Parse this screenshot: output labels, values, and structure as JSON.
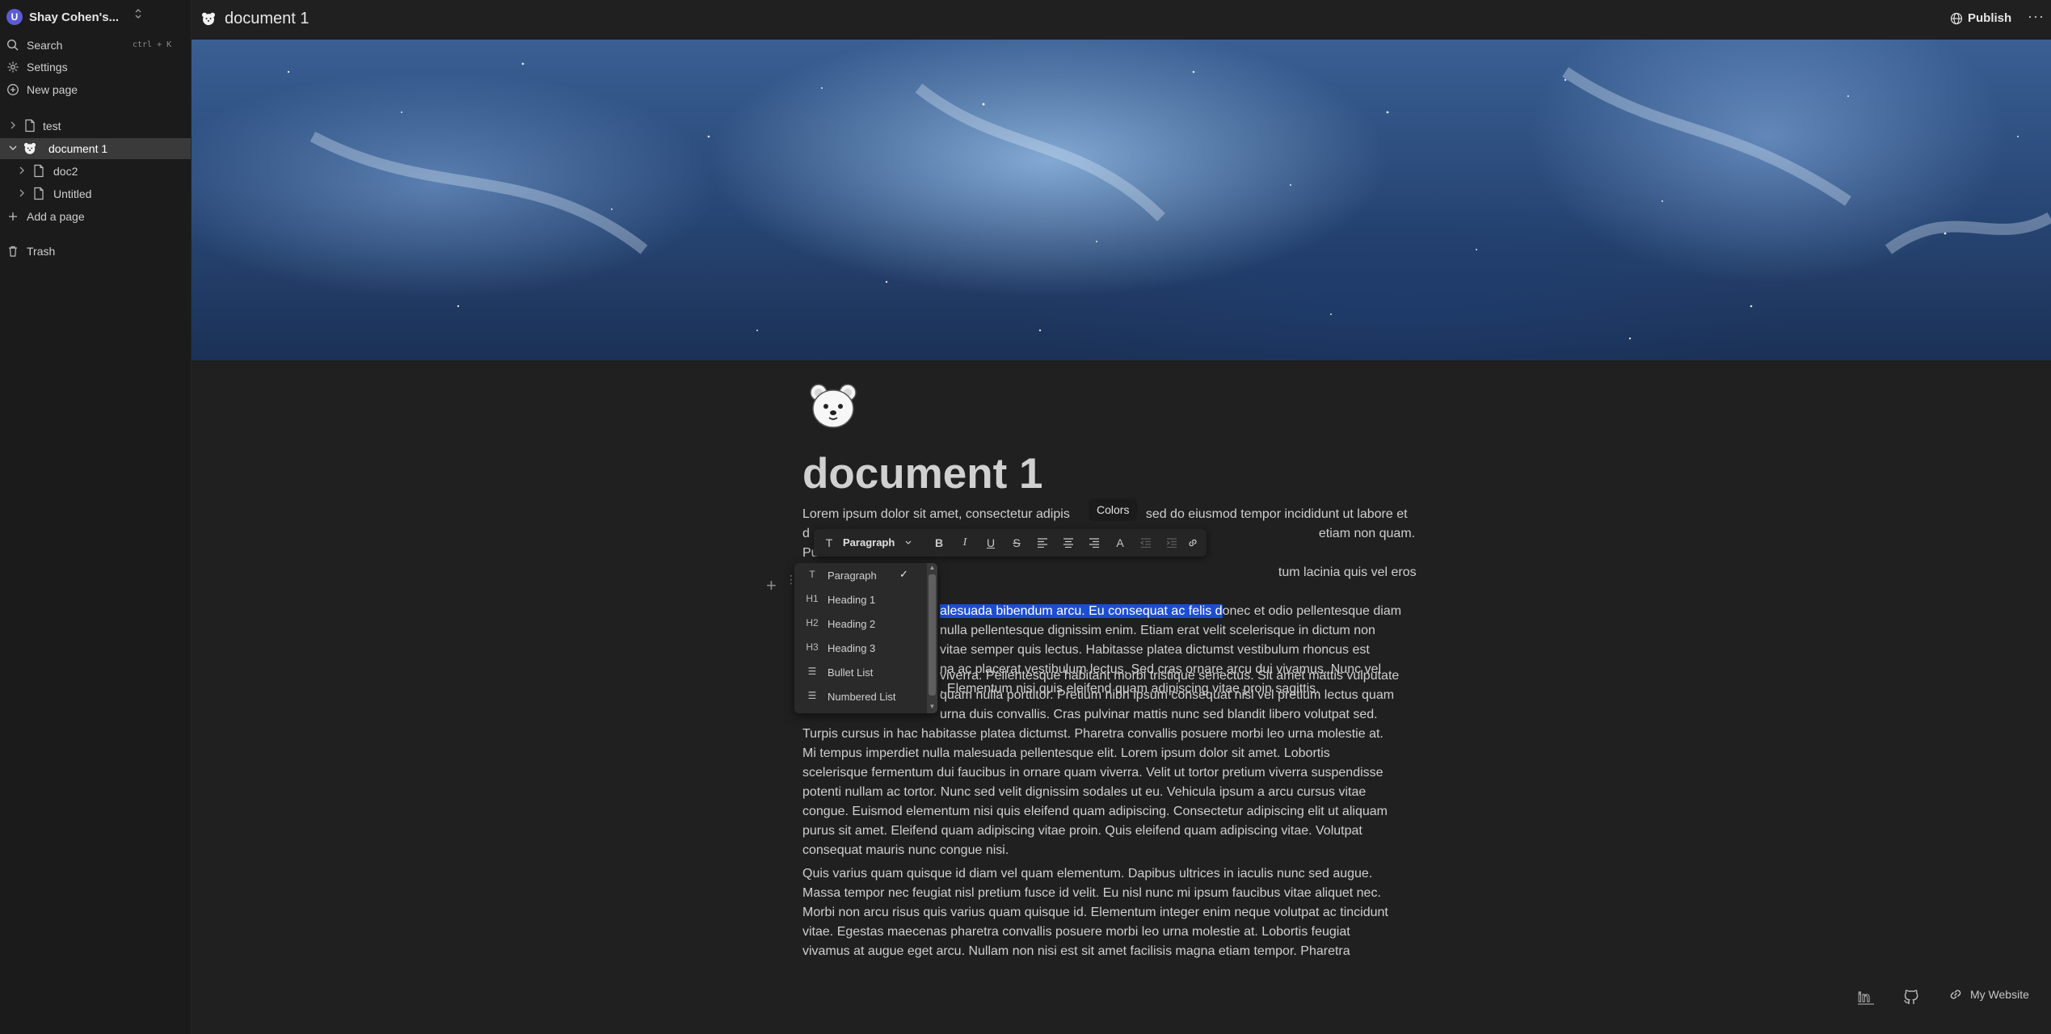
{
  "workspace": {
    "name": "Shay Cohen's...",
    "avatar_letter": "U"
  },
  "sidebar": {
    "search_label": "Search",
    "search_shortcut": "ctrl + K",
    "settings_label": "Settings",
    "new_page_label": "New page",
    "pages": [
      {
        "label": "test",
        "icon": "page-icon"
      },
      {
        "label": "document 1",
        "icon": "bear-emoji",
        "active": true,
        "expanded": true
      },
      {
        "label": "doc2",
        "icon": "page-icon"
      },
      {
        "label": "Untitled",
        "icon": "page-icon"
      }
    ],
    "add_page_label": "Add a page",
    "trash_label": "Trash"
  },
  "topbar": {
    "title": "document 1",
    "publish_label": "Publish",
    "more_label": "···"
  },
  "document": {
    "title": "document 1",
    "p1": {
      "a": "Lorem ipsum dolor sit amet, consectetur adipis",
      "b": "sed do eiusmod tempor incididunt ut labore et",
      "c": "d",
      "d": "etiam non quam. Purus ut faucibus",
      "e": "p",
      "f": "tum lacinia quis vel eros donec ac.",
      "selected": "alesuada bibendum arcu. Eu consequat ac felis d",
      "g": "onec et odio pellentesque diam",
      "h": "nulla pellentesque dignissim enim. Etiam erat velit scelerisque in dictum non",
      "i": "vitae semper quis lectus. Habitasse platea dictumst vestibulum rhoncus est",
      "j": "na ac placerat vestibulum lectus. Sed cras ornare arcu dui vivamus. Nunc vel",
      "k": ". Elementum nisi quis eleifend quam adipiscing vitae proin sagittis."
    },
    "p2": {
      "a": "viverra. Pellentesque habitant morbi tristique senectus. Sit amet mattis vulputate",
      "b": "quam nulla porttitor. Pretium nibh ipsum consequat nisl vel pretium lectus quam",
      "c": "urna duis convallis. Cras pulvinar mattis nunc sed blandit libero volutpat sed.",
      "d": "Turpis cursus in hac habitasse platea dictumst. Pharetra convallis posuere morbi leo urna molestie at.",
      "e": "Mi tempus imperdiet nulla malesuada pellentesque elit. Lorem ipsum dolor sit amet. Lobortis",
      "f": "scelerisque fermentum dui faucibus in ornare quam viverra. Velit ut tortor pretium viverra suspendisse",
      "g": "potenti nullam ac tortor. Nunc sed velit dignissim sodales ut eu. Vehicula ipsum a arcu cursus vitae",
      "h": "congue. Euismod elementum nisi quis eleifend quam adipiscing. Consectetur adipiscing elit ut aliquam",
      "i": "purus sit amet. Eleifend quam adipiscing vitae proin. Quis eleifend quam adipiscing vitae. Volutpat",
      "j": "consequat mauris nunc congue nisi."
    },
    "p3": {
      "a": "Quis varius quam quisque id diam vel quam elementum. Dapibus ultrices in iaculis nunc sed augue.",
      "b": "Massa tempor nec feugiat nisl pretium fusce id velit. Eu nisl nunc mi ipsum faucibus vitae aliquet nec.",
      "c": "Morbi non arcu risus quis varius quam quisque id. Elementum integer enim neque volutpat ac tincidunt",
      "d": "vitae. Egestas maecenas pharetra convallis posuere morbi leo urna molestie at. Lobortis feugiat",
      "e": "vivamus at augue eget arcu. Nullam non nisi est sit amet facilisis magna etiam tempor. Pharetra"
    }
  },
  "toolbar": {
    "block_type": "Paragraph",
    "tooltip": "Colors",
    "buttons": [
      "bold",
      "italic",
      "underline",
      "strikethrough",
      "align-left",
      "align-center",
      "align-right",
      "text-color",
      "indent-decrease",
      "indent-increase",
      "link"
    ]
  },
  "block_menu": {
    "items": [
      {
        "glyph": "T",
        "label": "Paragraph",
        "checked": "✓"
      },
      {
        "glyph": "H1",
        "label": "Heading 1"
      },
      {
        "glyph": "H2",
        "label": "Heading 2"
      },
      {
        "glyph": "H3",
        "label": "Heading 3"
      },
      {
        "glyph": "☰",
        "label": "Bullet List"
      },
      {
        "glyph": "☰",
        "label": "Numbered List"
      }
    ]
  },
  "footer": {
    "website_label": "My Website"
  },
  "colors": {
    "selection": "#1c4fcf",
    "spellcheck": "#e04646",
    "accent": "#5b5bd6"
  }
}
